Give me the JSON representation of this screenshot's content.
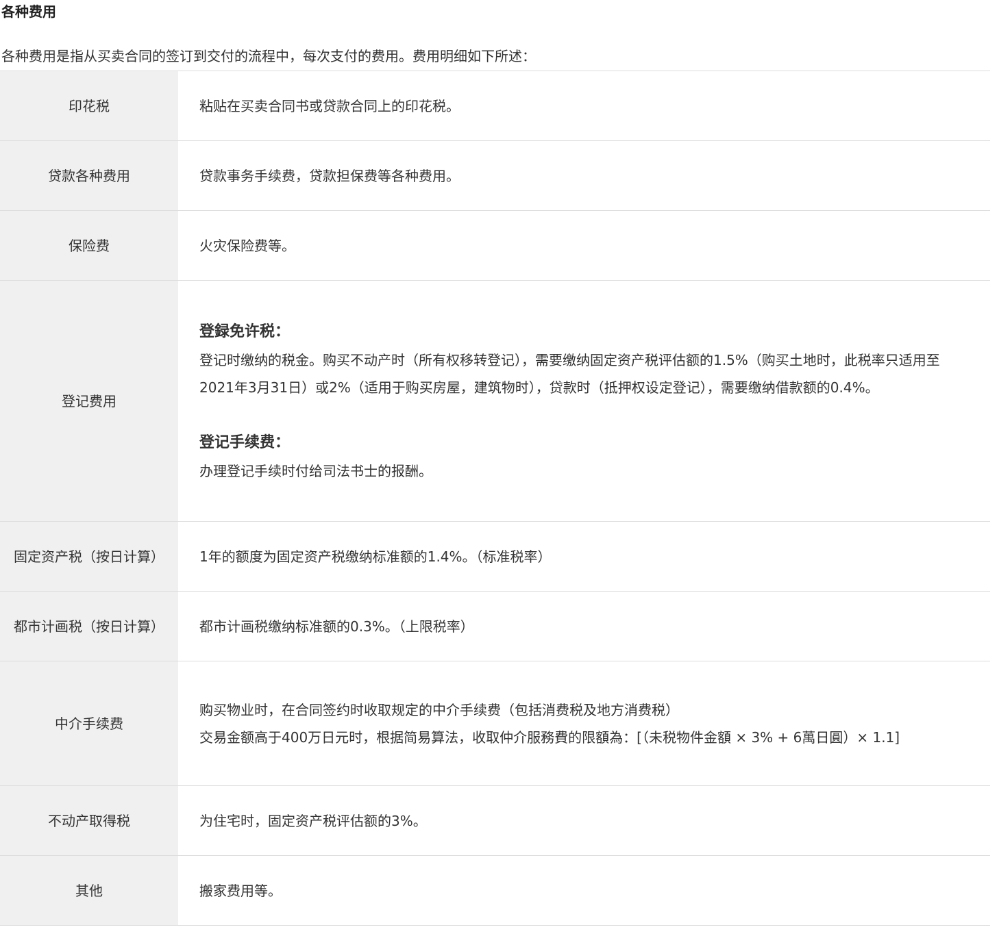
{
  "title": "各种费用",
  "intro": "各种费用是指从买卖合同的签订到交付的流程中，每次支付的费用。费用明细如下所述：",
  "rows": [
    {
      "label": "印花税",
      "desc": "粘贴在买卖合同书或贷款合同上的印花税。"
    },
    {
      "label": "贷款各种费用",
      "desc": "贷款事务手续费，贷款担保费等各种费用。"
    },
    {
      "label": "保险费",
      "desc": "火灾保险费等。"
    },
    {
      "label": "登记费用",
      "sections": [
        {
          "heading": "登録免许税：",
          "text": "登记时缴纳的税金。购买不动产时（所有权移转登记），需要缴纳固定资产税评估额的1.5%（购买土地时，此税率只适用至 2021年3月31日）或2%（适用于购买房屋，建筑物时），贷款时（抵押权设定登记），需要缴纳借款额的0.4%。"
        },
        {
          "heading": "登记手续费：",
          "text": "办理登记手续时付给司法书士的报酬。"
        }
      ]
    },
    {
      "label": "固定资产税（按日计算）",
      "desc": "1年的额度为固定资产税缴纳标准额的1.4%。（标准税率）"
    },
    {
      "label": "都市计画税（按日计算）",
      "desc": "都市计画税缴纳标准额的0.3%。（上限税率）"
    },
    {
      "label": "中介手续费",
      "lines": [
        "购买物业时，在合同签约时收取规定的中介手续费（包括消费税及地方消费税）",
        "交易金额高于400万日元时，根据简易算法，收取仲介服務費的限額為：[（未税物件金額 × 3% + 6萬日圓）× 1.1]"
      ]
    },
    {
      "label": "不动产取得税",
      "desc": "为住宅时，固定资产税评估额的3%。"
    },
    {
      "label": "其他",
      "desc": "搬家费用等。"
    }
  ]
}
